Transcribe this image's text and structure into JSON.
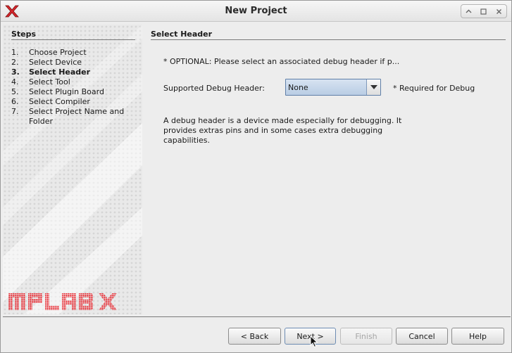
{
  "window": {
    "title": "New Project",
    "app_icon": "mplab-x-icon",
    "controls": [
      "minimize-icon",
      "maximize-icon",
      "close-icon"
    ]
  },
  "steps": {
    "title": "Steps",
    "items": [
      {
        "num": "1.",
        "label": "Choose Project",
        "current": false
      },
      {
        "num": "2.",
        "label": "Select Device",
        "current": false
      },
      {
        "num": "3.",
        "label": "Select Header",
        "current": true
      },
      {
        "num": "4.",
        "label": "Select Tool",
        "current": false
      },
      {
        "num": "5.",
        "label": "Select Plugin Board",
        "current": false
      },
      {
        "num": "6.",
        "label": "Select Compiler",
        "current": false
      },
      {
        "num": "7.",
        "label": "Select Project Name and Folder",
        "current": false
      }
    ],
    "logo_text": "MPLAB X",
    "logo_color": "#e8262e"
  },
  "content": {
    "title": "Select Header",
    "optional_note": "* OPTIONAL: Please select an associated debug header if p...",
    "debug_header_label": "Supported Debug Header:",
    "debug_header_value": "None",
    "required_note": "* Required for Debug",
    "description": "A debug header is a device made especially for debugging. It provides extras pins and in some cases extra debugging capabilities."
  },
  "buttons": {
    "back": "< Back",
    "next": "Next >",
    "finish": "Finish",
    "cancel": "Cancel",
    "help": "Help"
  },
  "colors": {
    "accent": "#5f7fa8",
    "selected_combo": "#c5d6ea"
  }
}
